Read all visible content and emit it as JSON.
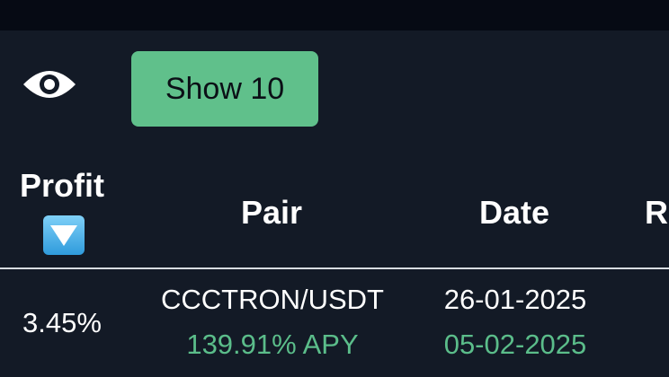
{
  "toolbar": {
    "visibility_icon": "eye-icon",
    "show_button_label": "Show 10",
    "show_button_color": "#60c08b"
  },
  "table": {
    "headers": {
      "profit": "Profit",
      "sort_icon": "sort-descending-icon",
      "pair": "Pair",
      "date": "Date",
      "partial_next": "R"
    },
    "rows": [
      {
        "profit": "3.45%",
        "pair": "CCCTRON/USDT",
        "apy": "139.91% APY",
        "date_start": "26-01-2025",
        "date_end": "05-02-2025"
      }
    ]
  },
  "colors": {
    "background": "#131a26",
    "top_strip": "#060a14",
    "accent_green": "#5bbd8a",
    "text": "#ffffff"
  }
}
